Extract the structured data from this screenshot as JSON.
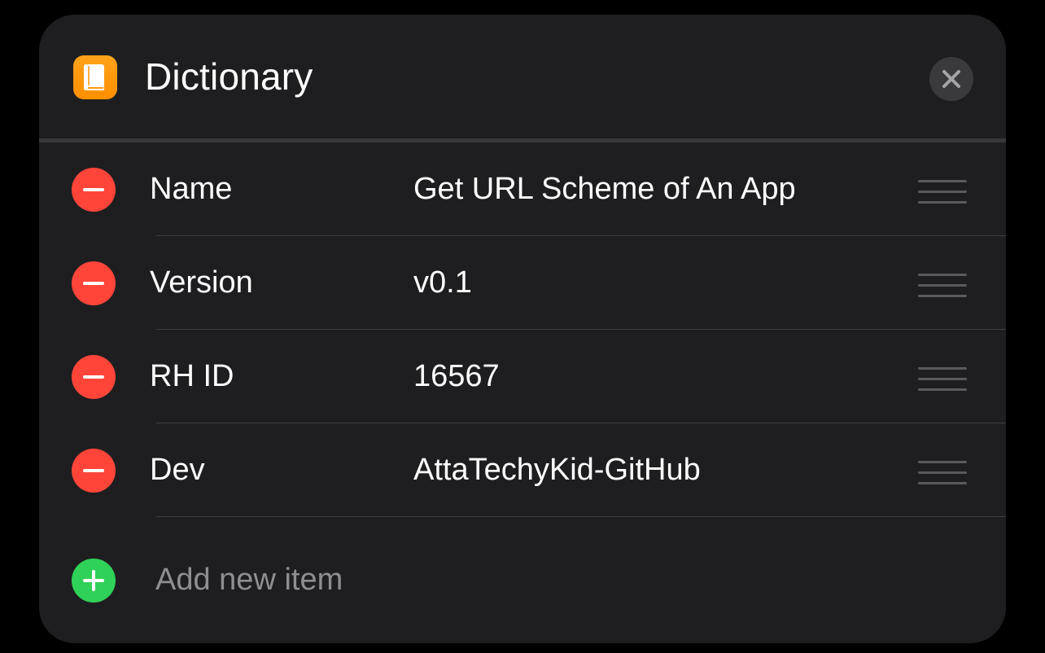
{
  "header": {
    "title": "Dictionary",
    "app_icon": "book-icon",
    "close_icon": "close-icon"
  },
  "items": [
    {
      "key": "Name",
      "value": "Get URL Scheme of An App"
    },
    {
      "key": "Version",
      "value": "v0.1"
    },
    {
      "key": "RH ID",
      "value": "16567"
    },
    {
      "key": "Dev",
      "value": "AttaTechyKid-GitHub"
    }
  ],
  "add_item": {
    "label": "Add new item",
    "icon": "plus-circle-icon"
  },
  "colors": {
    "background": "#000000",
    "card": "#1e1e20",
    "remove": "#ff453a",
    "add": "#30d158",
    "app_icon": "#ff9f0a",
    "placeholder_text": "#8e8e93"
  }
}
